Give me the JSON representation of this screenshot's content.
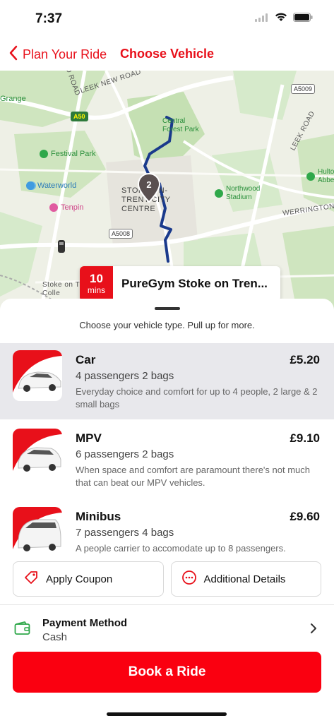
{
  "status": {
    "time": "7:37"
  },
  "header": {
    "back_label": "Plan Your Ride",
    "title": "Choose Vehicle"
  },
  "map": {
    "labels": {
      "leek_new_road": "LEEK NEW ROAD",
      "leek_road": "LEEK ROAD",
      "werrington": "WERRINGTON",
      "city_centre_1": "STOKE-ON-",
      "city_centre_2": "TRENT CITY",
      "city_centre_3": "CENTRE",
      "grange": "Grange",
      "festival_park": "Festival Park",
      "waterworld": "Waterworld",
      "tenpin": "Tenpin",
      "central_forest_park_1": "Central",
      "central_forest_park_2": "Forest Park",
      "northwood_1": "Northwood",
      "northwood_2": "Stadium",
      "hulton_1": "Hulto",
      "hulton_2": "Abbe",
      "stoke_coll_1": "Stoke on T",
      "stoke_coll_2": "Colle",
      "road_a50": "A50",
      "road_a5009": "A5009",
      "road_a5008": "A5008",
      "road_oo": "OO ROAD"
    },
    "marker_count": "2",
    "eta_value": "10",
    "eta_unit": "mins",
    "destination": "PureGym Stoke on Tren..."
  },
  "sheet": {
    "hint": "Choose your vehicle type. Pull up for more.",
    "vehicles": [
      {
        "name": "Car",
        "price": "£5.20",
        "capacity": "4 passengers  2 bags",
        "description": "Everyday choice and comfort for up to 4 people, 2 large & 2 small bags"
      },
      {
        "name": "MPV",
        "price": "£9.10",
        "capacity": "6 passengers  2 bags",
        "description": "When space and comfort are paramount there's not much that can beat our MPV vehicles."
      },
      {
        "name": "Minibus",
        "price": "£9.60",
        "capacity": "7 passengers  4 bags",
        "description": "A people carrier to accomodate up to 8 passengers."
      }
    ],
    "coupon_label": "Apply Coupon",
    "details_label": "Additional Details",
    "payment_title": "Payment Method",
    "payment_value": "Cash",
    "book_label": "Book a Ride"
  },
  "colors": {
    "brand_red": "#e8101a",
    "book_red": "#fa0010",
    "route_blue": "#1a3a8c",
    "selected_bg": "#e8e8ec"
  }
}
